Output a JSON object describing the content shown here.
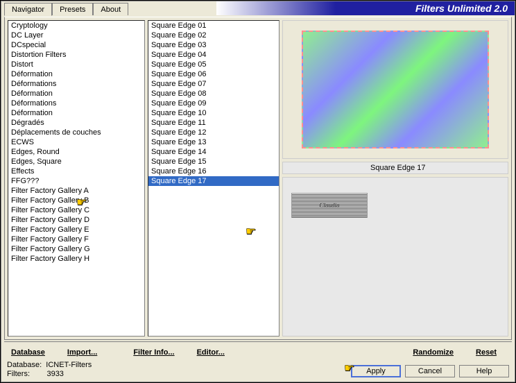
{
  "app": {
    "title": "Filters Unlimited 2.0"
  },
  "tabs": [
    {
      "label": "Navigator",
      "active": true
    },
    {
      "label": "Presets",
      "active": false
    },
    {
      "label": "About",
      "active": false
    }
  ],
  "nav_items": [
    "Cryptology",
    "DC Layer",
    "DCspecial",
    "Distortion Filters",
    "Distort",
    "Déformation",
    "Déformations",
    "Déformation",
    "Déformations",
    "Déformation",
    "Dégradés",
    "Déplacements de couches",
    "ECWS",
    "Edges, Round",
    "Edges, Square",
    "Effects",
    "FFG???",
    "Filter Factory Gallery A",
    "Filter Factory Gallery B",
    "Filter Factory Gallery C",
    "Filter Factory Gallery D",
    "Filter Factory Gallery E",
    "Filter Factory Gallery F",
    "Filter Factory Gallery G",
    "Filter Factory Gallery H"
  ],
  "nav_highlighted_index": 14,
  "filter_items": [
    "Square Edge 01",
    "Square Edge 02",
    "Square Edge 03",
    "Square Edge 04",
    "Square Edge 05",
    "Square Edge 06",
    "Square Edge 07",
    "Square Edge 08",
    "Square Edge 09",
    "Square Edge 10",
    "Square Edge 11",
    "Square Edge 12",
    "Square Edge 13",
    "Square Edge 14",
    "Square Edge 15",
    "Square Edge 16",
    "Square Edge 17"
  ],
  "filter_selected_index": 16,
  "selected_filter_name": "Square Edge 17",
  "link_buttons": {
    "database": "Database",
    "import": "Import...",
    "filterinfo": "Filter Info...",
    "editor": "Editor...",
    "randomize": "Randomize",
    "reset": "Reset"
  },
  "status": {
    "db_label": "Database:",
    "db_value": "ICNET-Filters",
    "filters_label": "Filters:",
    "filters_value": "3933"
  },
  "buttons": {
    "apply": "Apply",
    "cancel": "Cancel",
    "help": "Help"
  },
  "watermark": "Claudia"
}
